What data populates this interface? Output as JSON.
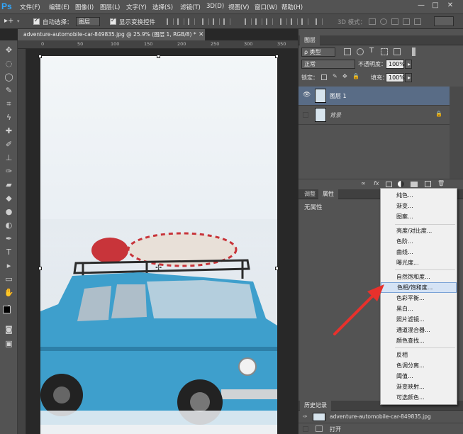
{
  "app": {
    "logo": "Ps"
  },
  "menu": [
    "文件(F)",
    "编辑(E)",
    "图像(I)",
    "图层(L)",
    "文字(Y)",
    "选择(S)",
    "滤镜(T)",
    "3D(D)",
    "视图(V)",
    "窗口(W)",
    "帮助(H)"
  ],
  "options": {
    "auto_select_label": "自动选择：",
    "auto_select_value": "图层",
    "show_transform": "显示变换控件",
    "mode3d": "3D 模式："
  },
  "document": {
    "tab_title": "adventure-automobile-car-849835.jpg @ 25.9% (图层 1, RGB/8) *"
  },
  "ruler": {
    "top": [
      "0",
      "50",
      "100",
      "150",
      "200",
      "250",
      "300",
      "350"
    ]
  },
  "layers_panel": {
    "tab": "图层",
    "kind_label": "ρ 类型",
    "blend_mode": "正常",
    "opacity_label": "不透明度：",
    "opacity_value": "100%",
    "lock_label": "锁定：",
    "fill_label": "填充：",
    "fill_value": "100%",
    "layers": [
      {
        "name": "图层 1",
        "selected": true
      },
      {
        "name": "背景",
        "locked": true
      }
    ]
  },
  "properties_panel": {
    "tabs": [
      "调整",
      "属性"
    ],
    "content": "无属性"
  },
  "adjustment_menu": {
    "groups": [
      [
        "纯色...",
        "渐变...",
        "图案..."
      ],
      [
        "亮度/对比度...",
        "色阶...",
        "曲线...",
        "曝光度..."
      ],
      [
        "自然饱和度...",
        "色相/饱和度...",
        "色彩平衡...",
        "黑白...",
        "照片滤镜...",
        "通道混合器...",
        "颜色查找..."
      ],
      [
        "反相",
        "色调分离...",
        "阈值...",
        "渐变映射...",
        "可选颜色..."
      ]
    ],
    "highlighted": "色相/饱和度..."
  },
  "history_panel": {
    "tab": "历史记录",
    "snapshot": "adventure-automobile-car-849835.jpg",
    "items": [
      "打开"
    ]
  },
  "colors": {
    "accent": "#31a8ff",
    "arrow": "#e8312c",
    "car": "#3e9fcc",
    "tube": "#c8343a"
  }
}
